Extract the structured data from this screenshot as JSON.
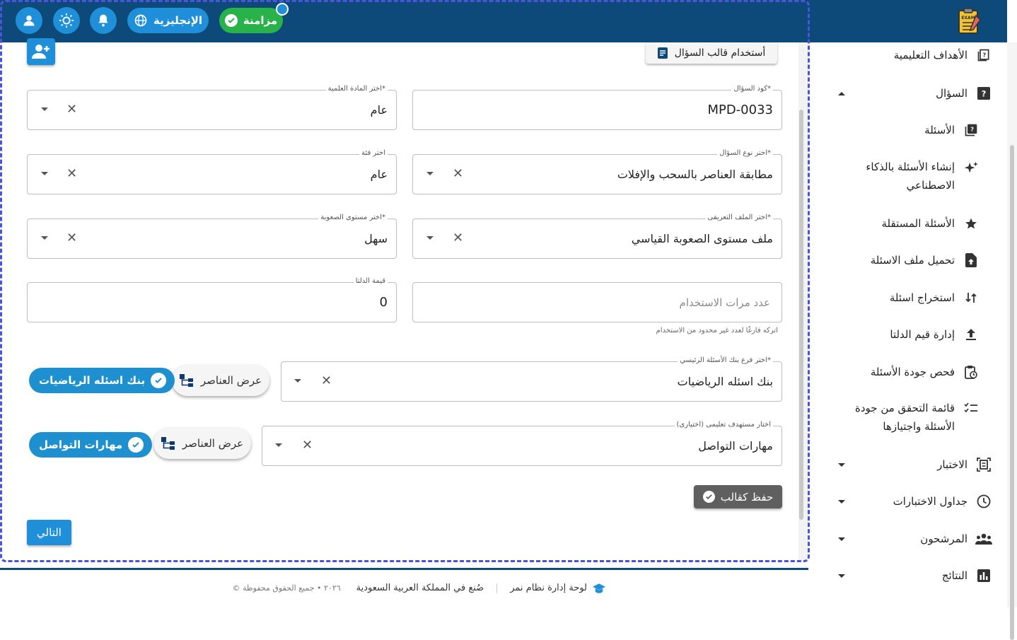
{
  "topbar": {
    "sync_label": "مزامنة",
    "language_label": "الإنجليزية",
    "logo_text": "EXAM"
  },
  "header_actions": {
    "template_button": "أستخدام قالب السؤال"
  },
  "form": {
    "question_code": {
      "label": "كود السؤال*",
      "value": "MPD-0033"
    },
    "subject": {
      "label": "اختر المادة العلمية*",
      "value": "عام"
    },
    "question_type": {
      "label": "اختر نوع السؤال*",
      "value": "مطابقة العناصر  بالسحب والإفلات"
    },
    "category": {
      "label": "اختر فئة",
      "value": "عام"
    },
    "definition_file": {
      "label": "اختر الملف التعريفى*",
      "value": "ملف مستوى الصعوبة القياسي"
    },
    "difficulty": {
      "label": "اختر مستوى الصعوبة*",
      "value": "سهل"
    },
    "usage_count": {
      "placeholder": "عدد مرات الاستخدام",
      "helper": "اتركه فارغًا لعدد غير محدود من الاستخدام"
    },
    "delta_value": {
      "label": "قيمة الدلتا",
      "value": "0"
    },
    "bank_branch": {
      "label": "اختر فرع بنك الأسئلة الرئيسي*",
      "value": "بنك اسئله الرياضيات",
      "show_button": "عرض العناصر",
      "chip": "بنك اسئله الرياضيات"
    },
    "learning_target": {
      "label": "اختار مستهدف تعليمى (اختيارى)",
      "value": "مهارات التواصل",
      "show_button": "عرض العناصر",
      "chip": "مهارات التواصل"
    },
    "save_template": "حفظ كقالب",
    "next": "التالي"
  },
  "footer": {
    "brand": "لوحة إدارة نظام نمر",
    "made_in": "صُنع في المملكة العربية السعودية",
    "copyright": "© ٢٠٢٦ • جميع الحقوق محفوظة"
  },
  "sidebar": {
    "items": [
      {
        "label": "الأهداف التعليمية",
        "icon": "book-question-icon"
      },
      {
        "label": "السؤال",
        "icon": "question-box-icon"
      },
      {
        "label": "الأسئلة",
        "icon": "question-library-icon"
      },
      {
        "label": "إنشاء الأسئلة بالذكاء",
        "label2": "الاصطناعي",
        "icon": "sparkles-icon"
      },
      {
        "label": "الأسئلة المستقلة",
        "icon": "star-icon"
      },
      {
        "label": "تحميل ملف الاسئلة",
        "icon": "file-upload-icon"
      },
      {
        "label": "استخراج اسئلة",
        "icon": "swap-vertical-icon"
      },
      {
        "label": "إدارة قيم الدلتا",
        "icon": "upload-icon"
      },
      {
        "label": "فحص جودة الأسئلة",
        "icon": "clipboard-clock-icon"
      },
      {
        "label": "قائمة التحقق من جودة",
        "label2": "الأسئلة واجتيازها",
        "icon": "checklist-icon"
      },
      {
        "label": "الاختبار",
        "icon": "exam-frame-icon"
      },
      {
        "label": "جداول الاختبارات",
        "icon": "clock-icon"
      },
      {
        "label": "المرشحون",
        "icon": "people-icon"
      },
      {
        "label": "النتائج",
        "icon": "bar-chart-icon"
      }
    ]
  },
  "colors": {
    "topbar": "#0d4a7a",
    "sync_green": "#2ab24a",
    "accent_blue": "#1e8fd8",
    "frame_dashed": "#4a54d8"
  }
}
